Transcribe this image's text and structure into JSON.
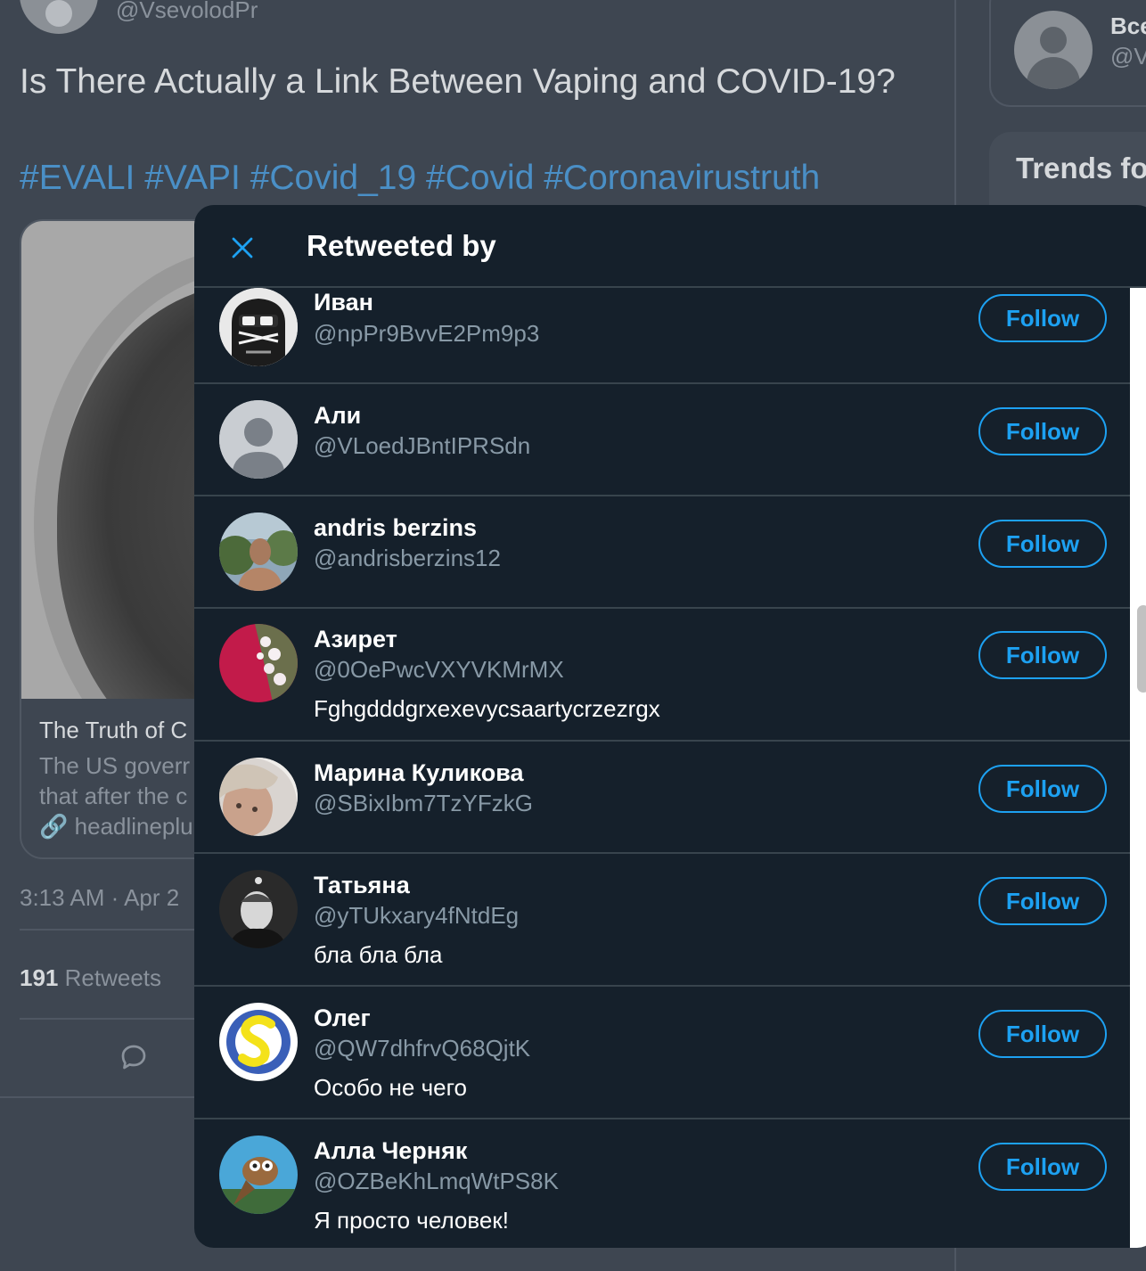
{
  "background": {
    "tweet_handle": "@VsevolodPr",
    "tweet_text": "Is There Actually a Link Between Vaping and COVID-19?",
    "hashtags": "#EVALI #VAPI #Covid_19 #Covid #Coronavirustruth",
    "card_title": "The Truth of C",
    "card_desc_line1": "The US goverr",
    "card_desc_line2": "that after the c",
    "card_link": "headlineplu",
    "timestamp": "3:13 AM · Apr 2",
    "retweet_count": "191",
    "retweet_label": "Retweets",
    "sidebar_name": "Все",
    "sidebar_handle": "@V",
    "trends_label": "Trends fo"
  },
  "modal": {
    "title": "Retweeted by",
    "follow_label": "Follow",
    "users": [
      {
        "name": "Иван",
        "handle": "@npPr9BvvE2Pm9p3",
        "bio": "",
        "avatar": "ninja-avatar"
      },
      {
        "name": "Али",
        "handle": "@VLoedJBntIPRSdn",
        "bio": "",
        "avatar": "default-avatar"
      },
      {
        "name": "andris berzins",
        "handle": "@andrisberzins12",
        "bio": "",
        "avatar": "photo-avatar"
      },
      {
        "name": "Азирет",
        "handle": "@0OePwcVXYVKMrMX",
        "bio": "Fghgdddgrxexevycsaartycrzezrgx",
        "avatar": "flowers-avatar"
      },
      {
        "name": "Марина Куликова",
        "handle": "@SBixIbm7TzYFzkG",
        "bio": "",
        "avatar": "photo-avatar"
      },
      {
        "name": "Татьяна",
        "handle": "@yTUkxary4fNtdEg",
        "bio": "бла бла бла",
        "avatar": "photo-avatar"
      },
      {
        "name": "Олег",
        "handle": "@QW7dhfrvQ68QjtK",
        "bio": "Особо не чего",
        "avatar": "logo-avatar"
      },
      {
        "name": "Алла Черняк",
        "handle": "@OZBeKhLmqWtPS8K",
        "bio": "Я просто человек!",
        "avatar": "cartoon-avatar"
      }
    ]
  },
  "colors": {
    "accent": "#1da1f2",
    "modal_bg": "#15202b",
    "divider": "#38444d",
    "secondary_text": "#8899a6"
  }
}
